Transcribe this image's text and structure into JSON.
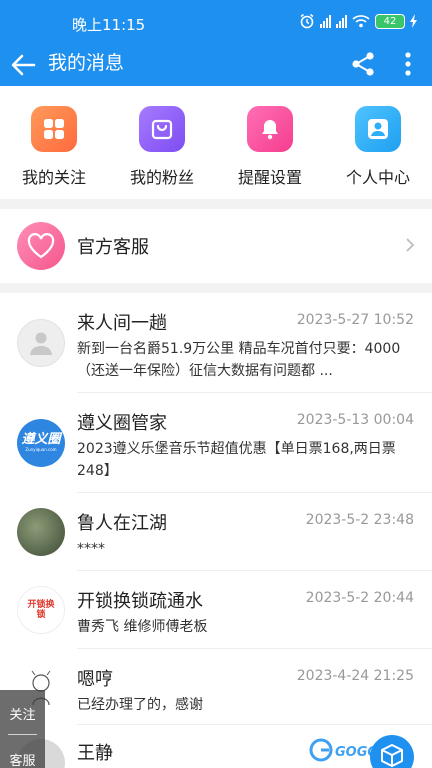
{
  "status_bar": {
    "time": "晚上11:15",
    "battery": "42",
    "signal_label": "HD"
  },
  "app_bar": {
    "title": "我的消息"
  },
  "quick_actions": [
    {
      "label": "我的关注",
      "icon": "grid-icon",
      "color": "#ff7a45"
    },
    {
      "label": "我的粉丝",
      "icon": "bag-icon",
      "color": "#8a5cf5"
    },
    {
      "label": "提醒设置",
      "icon": "bell-icon",
      "color": "#f94fa0"
    },
    {
      "label": "个人中心",
      "icon": "person-icon",
      "color": "#2eaef7"
    }
  ],
  "official": {
    "name": "官方客服"
  },
  "messages": [
    {
      "name": "来人间一趟",
      "time": "2023-5-27 10:52",
      "text": "新到一台名爵51.9万公里 精品车况首付只要：4000（还送一年保险）征信大数据有问题都 ..."
    },
    {
      "name": "遵义圈管家",
      "time": "2023-5-13 00:04",
      "text": "2023遵义乐堡音乐节超值优惠【单日票168,两日票248】",
      "avatar_text": "遵义圈",
      "avatar_sub": "Zunyiquan.com"
    },
    {
      "name": "鲁人在江湖",
      "time": "2023-5-2 23:48",
      "text": "****"
    },
    {
      "name": "开锁换锁疏通水",
      "time": "2023-5-2 20:44",
      "text": "曹秀飞 维修师傅老板",
      "avatar_text": "开锁换锁"
    },
    {
      "name": "嗯哼",
      "time": "2023-4-24 21:25",
      "text": "已经办理了的，感谢"
    },
    {
      "name": "王静",
      "time": "",
      "text": ""
    }
  ],
  "side_tab": {
    "follow": "关注",
    "service": "客服"
  },
  "watermark": {
    "text": "GOGO手游"
  },
  "colors": {
    "primary": "#1e90f0",
    "text": "#222222",
    "muted": "#999999"
  }
}
